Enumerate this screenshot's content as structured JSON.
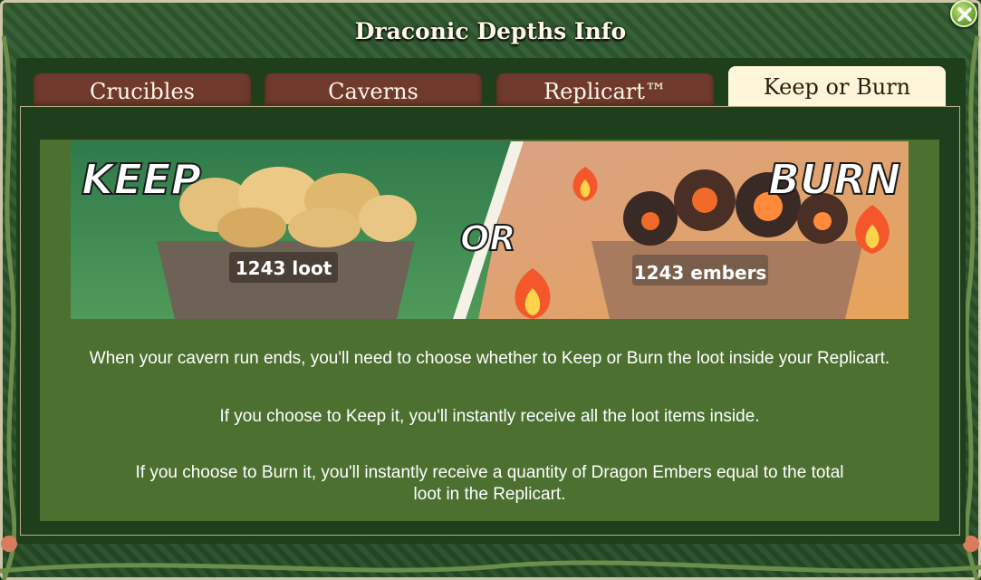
{
  "window": {
    "title": "Draconic Depths Info"
  },
  "tabs": [
    {
      "label": "Crucibles",
      "active": false
    },
    {
      "label": "Caverns",
      "active": false
    },
    {
      "label": "Replicart™",
      "active": false
    },
    {
      "label": "Keep or Burn",
      "active": true
    }
  ],
  "banner": {
    "keep_label": "KEEP",
    "or_label": "OR",
    "burn_label": "BURN",
    "keep_count": "1243 loot",
    "burn_count": "1243 embers"
  },
  "paragraphs": [
    "When your cavern run ends, you'll need to choose whether to Keep or Burn the loot inside your Replicart.",
    "If you choose to Keep it, you'll instantly receive all the loot items inside.",
    "If you choose to Burn it, you'll instantly receive a quantity of Dragon Embers equal to the total loot in the Replicart."
  ],
  "colors": {
    "panel_green": "#4b7030",
    "tab_inactive": "#6f3a2c",
    "tab_active": "#fdf6d8",
    "frame": "#2f5a2f"
  },
  "icons": [
    "close-icon",
    "flame-icon",
    "loot-bag-icon",
    "ember-icon",
    "cart-icon"
  ]
}
